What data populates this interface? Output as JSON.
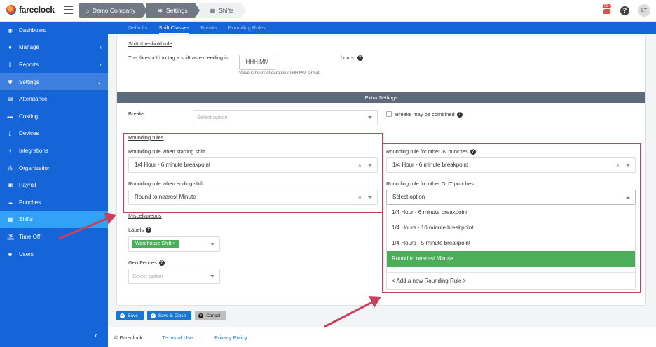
{
  "app": {
    "name": "fareclock"
  },
  "breadcrumbs": [
    {
      "label": "Demo Company",
      "icon": "home-icon"
    },
    {
      "label": "Settings",
      "icon": "gear-icon"
    },
    {
      "label": "Shifts",
      "icon": "calendar-icon"
    }
  ],
  "header": {
    "notification_count": "99+",
    "help": "?",
    "avatar_initials": "LT"
  },
  "sidebar": {
    "items": [
      {
        "label": "Dashboard",
        "icon": "dashboard-icon"
      },
      {
        "label": "Manage",
        "icon": "person-icon"
      },
      {
        "label": "Reports",
        "icon": "chart-icon"
      },
      {
        "label": "Settings",
        "icon": "gear-icon"
      },
      {
        "label": "Attendance",
        "icon": "grid-icon"
      },
      {
        "label": "Costing",
        "icon": "folder-icon"
      },
      {
        "label": "Devices",
        "icon": "tablet-icon"
      },
      {
        "label": "Integrations",
        "icon": "plug-icon"
      },
      {
        "label": "Organization",
        "icon": "org-chart-icon"
      },
      {
        "label": "Payroll",
        "icon": "money-icon"
      },
      {
        "label": "Punches",
        "icon": "cloud-icon"
      },
      {
        "label": "Shifts",
        "icon": "calendar-icon"
      },
      {
        "label": "Time Off",
        "icon": "beach-icon"
      },
      {
        "label": "Users",
        "icon": "users-icon"
      }
    ]
  },
  "tabs": [
    "Defaults",
    "Shift Classes",
    "Breaks",
    "Rounding Rules"
  ],
  "threshold": {
    "section": "Shift threshold rule",
    "label": "The threshold to tag a shift as exceeding is",
    "placeholder": "HHH:MM",
    "unit": "hours.",
    "hint": "Value is hours of duration in HH:MM format."
  },
  "extra_settings": "Extra Settings",
  "breaks": {
    "label": "Breaks",
    "placeholder": "Select option",
    "combine_label": "Breaks may be combined"
  },
  "rounding": {
    "section": "Rounding rules",
    "start_label": "Rounding rule when starting shift",
    "start_value": "1/4 Hour - 6 minute breakpoint",
    "end_label": "Rounding rule when ending shift",
    "end_value": "Round to nearest Minute",
    "other_in_label": "Rounding rule for other IN punches",
    "other_in_value": "1/4 Hour - 6 minute breakpoint",
    "other_out_label": "Rounding rule for other OUT punches",
    "other_out_placeholder": "Select option",
    "options": [
      "1/4 Hour - 6 minute breakpoint",
      "1/4 Hours - 10 minute breakpoint",
      "1/4 Hours - 5 minute breakpoint",
      "Round to nearest Minute"
    ],
    "add_new": "< Add a new Rounding Rule >"
  },
  "misc": {
    "section": "Miscellaneous",
    "labels_label": "Labels",
    "label_chip": "Warehouse Shift",
    "geo_label": "Geo Fences",
    "geo_placeholder": "Select option"
  },
  "buttons": {
    "save": "Save",
    "save_close": "Save & Close",
    "cancel": "Cancel"
  },
  "footer": {
    "copyright": "© Fareclock",
    "terms": "Terms of Use",
    "privacy": "Privacy Policy"
  },
  "colors": {
    "primary": "#1565d8",
    "active_nav": "#31a2f5",
    "success": "#4cae5a",
    "highlight": "#c8415c"
  }
}
